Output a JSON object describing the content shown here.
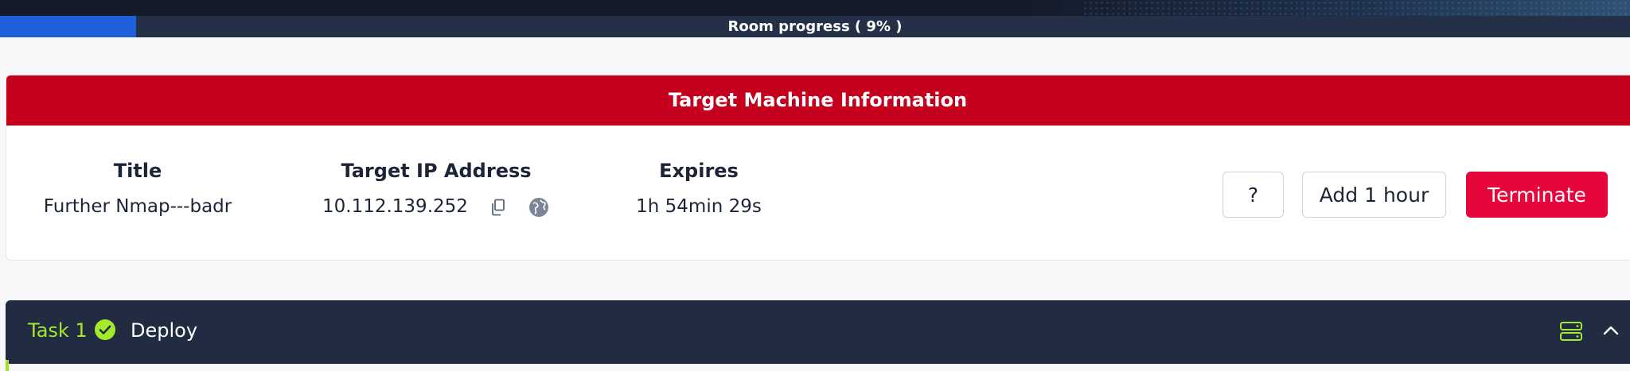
{
  "progress": {
    "label": "Room progress ( 9% )",
    "percent": 9,
    "fill_color": "#1f5fdc"
  },
  "machine": {
    "header": "Target Machine Information",
    "header_color": "#c4001d",
    "title_label": "Title",
    "title_value": "Further Nmap---badr",
    "ip_label": "Target IP Address",
    "ip_value": "10.112.139.252",
    "expires_label": "Expires",
    "expires_value": "1h 54min 29s",
    "buttons": {
      "help": "?",
      "add_hour": "Add 1 hour",
      "terminate": "Terminate"
    },
    "terminate_color": "#e6063c",
    "icons": [
      "copy-icon",
      "globe-icon"
    ]
  },
  "task": {
    "label": "Task 1",
    "title": "Deploy",
    "status": "completed",
    "accent_color": "#a3ea2a",
    "icons": [
      "check-circle-icon",
      "server-icon",
      "chevron-up-icon"
    ]
  }
}
